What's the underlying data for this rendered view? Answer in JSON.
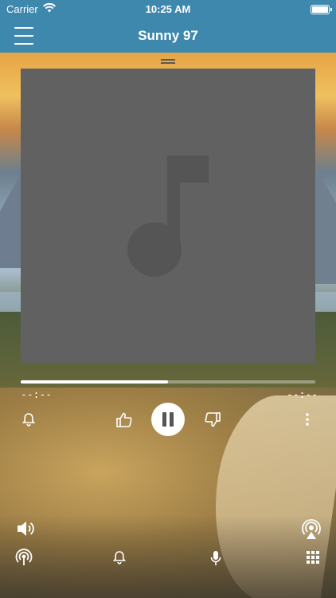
{
  "status_bar": {
    "carrier": "Carrier",
    "time": "10:25 AM"
  },
  "nav": {
    "title": "Sunny 97"
  },
  "player": {
    "elapsed": "--:--",
    "remaining": "--:--",
    "progress_fraction": 0.5
  },
  "colors": {
    "accent": "#3f88ad",
    "art_bg": "#616161",
    "note": "#555555"
  },
  "icons": {
    "menu": "hamburger-menu-icon",
    "alarm": "bell-icon",
    "like": "thumbs-up-icon",
    "pause": "pause-icon",
    "dislike": "thumbs-down-icon",
    "more": "more-vertical-icon",
    "volume": "volume-icon",
    "airplay": "airplay-icon",
    "station": "broadcast-icon",
    "mic": "microphone-icon",
    "grid": "grid-icon"
  }
}
